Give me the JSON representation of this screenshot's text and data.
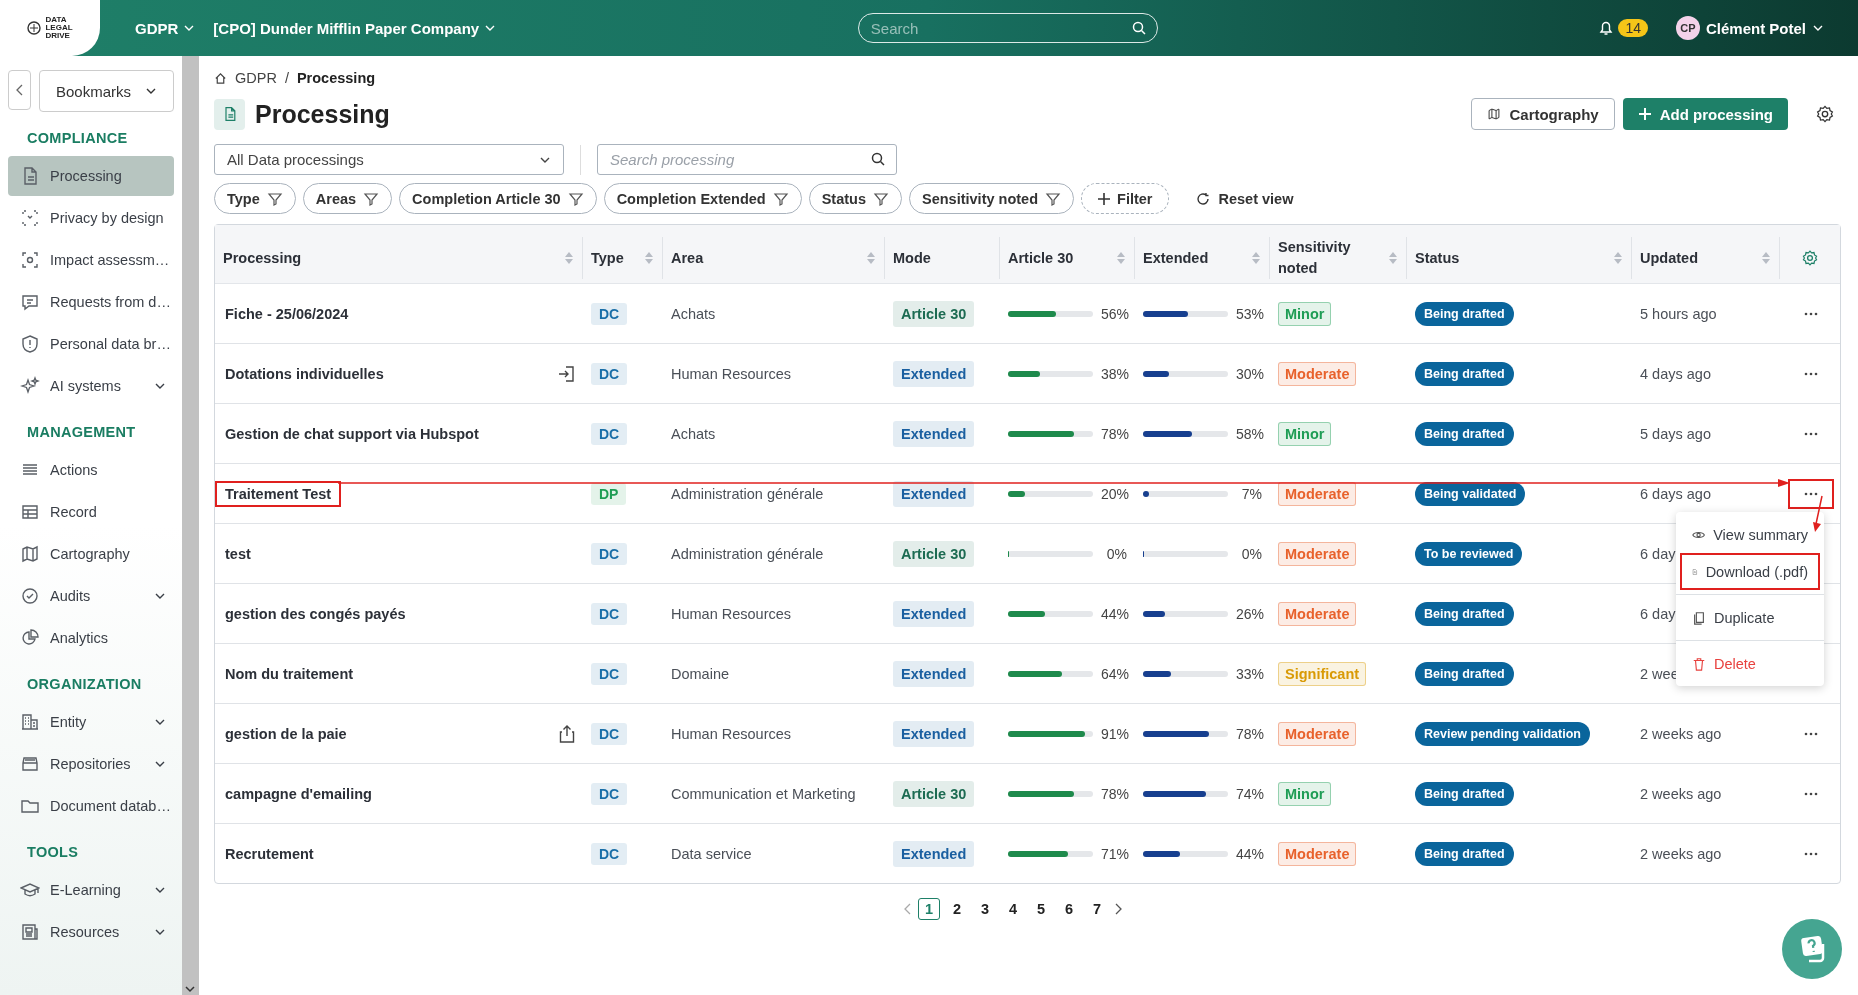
{
  "logo_text": [
    "DATA",
    "LEGAL",
    "DRIVE"
  ],
  "topbar": {
    "module": "GDPR",
    "company": "[CPO] Dunder Mifflin Paper Company",
    "search": {
      "placeholder": "Search"
    },
    "notifications": "14",
    "user_initials": "CP",
    "user_name": "Clément Potel"
  },
  "sidebar": {
    "bookmarks": "Bookmarks",
    "sections": [
      {
        "title": "COMPLIANCE",
        "items": [
          {
            "label": "Processing",
            "selected": true
          },
          {
            "label": "Privacy by design",
            "selected": false
          },
          {
            "label": "Impact assessm…",
            "selected": false
          },
          {
            "label": "Requests from d…",
            "selected": false
          },
          {
            "label": "Personal data br…",
            "selected": false
          },
          {
            "label": "AI systems",
            "selected": false,
            "expandable": true
          }
        ]
      },
      {
        "title": "MANAGEMENT",
        "items": [
          {
            "label": "Actions",
            "selected": false
          },
          {
            "label": "Record",
            "selected": false
          },
          {
            "label": "Cartography",
            "selected": false
          },
          {
            "label": "Audits",
            "selected": false,
            "expandable": true
          },
          {
            "label": "Analytics",
            "selected": false
          }
        ]
      },
      {
        "title": "ORGANIZATION",
        "items": [
          {
            "label": "Entity",
            "selected": false,
            "expandable": true
          },
          {
            "label": "Repositories",
            "selected": false,
            "expandable": true
          },
          {
            "label": "Document datab…",
            "selected": false
          }
        ]
      },
      {
        "title": "TOOLS",
        "items": [
          {
            "label": "E-Learning",
            "selected": false,
            "expandable": true
          },
          {
            "label": "Resources",
            "selected": false,
            "expandable": true
          }
        ]
      }
    ]
  },
  "breadcrumb": {
    "items": [
      "GDPR",
      "Processing"
    ],
    "separator": "/"
  },
  "page_title": "Processing",
  "buttons": {
    "cartography": "Cartography",
    "add": "Add processing"
  },
  "view_select": "All Data processings",
  "search": {
    "placeholder": "Search processing"
  },
  "filters": [
    "Type",
    "Areas",
    "Completion Article 30",
    "Completion Extended",
    "Status",
    "Sensitivity noted"
  ],
  "add_filter": "Filter",
  "reset_view": "Reset view",
  "table": {
    "columns": [
      {
        "label": "Processing",
        "sortable": true
      },
      {
        "label": "Type",
        "sortable": true
      },
      {
        "label": "Area",
        "sortable": true
      },
      {
        "label": "Mode",
        "sortable": false
      },
      {
        "label": "Article 30",
        "sortable": true
      },
      {
        "label": "Extended",
        "sortable": true
      },
      {
        "label": "Sensitivity noted",
        "sortable": true
      },
      {
        "label": "Status",
        "sortable": true
      },
      {
        "label": "Updated",
        "sortable": true
      }
    ],
    "rows": [
      {
        "name": "Fiche - 25/06/2024",
        "type": {
          "text": "DC",
          "color": "#1a6fa8"
        },
        "area": "Achats",
        "mode": {
          "text": "Article 30",
          "color": "#1c6b52"
        },
        "article30": {
          "level": 0.56,
          "text": "56%"
        },
        "extended": {
          "level": 0.53,
          "text": "53%"
        },
        "sensitivity": {
          "text": "Minor",
          "color": "#1f9d55"
        },
        "status": "Being drafted",
        "updated": "5 hours ago",
        "highlighted": false
      },
      {
        "name": "Dotations individuelles",
        "imported": true,
        "type": {
          "text": "DC",
          "color": "#1a6fa8"
        },
        "area": "Human Resources",
        "mode": {
          "text": "Extended",
          "color": "#1a5fa0"
        },
        "article30": {
          "level": 0.38,
          "text": "38%"
        },
        "extended": {
          "level": 0.3,
          "text": "30%"
        },
        "sensitivity": {
          "text": "Moderate",
          "color": "#e8622c"
        },
        "status": "Being drafted",
        "updated": "4 days ago",
        "highlighted": false
      },
      {
        "name": "Gestion de chat support via Hubspot",
        "type": {
          "text": "DC",
          "color": "#1a6fa8"
        },
        "area": "Achats",
        "mode": {
          "text": "Extended",
          "color": "#1a5fa0"
        },
        "article30": {
          "level": 0.78,
          "text": "78%"
        },
        "extended": {
          "level": 0.58,
          "text": "58%"
        },
        "sensitivity": {
          "text": "Minor",
          "color": "#1f9d55"
        },
        "status": "Being drafted",
        "updated": "5 days ago",
        "highlighted": false
      },
      {
        "name": "Traitement Test",
        "type": {
          "text": "DP",
          "color": "#1f9d55"
        },
        "area": "Administration générale",
        "mode": {
          "text": "Extended",
          "color": "#1a5fa0"
        },
        "article30": {
          "level": 0.2,
          "text": "20%"
        },
        "extended": {
          "level": 0.07,
          "text": "7%"
        },
        "sensitivity": {
          "text": "Moderate",
          "color": "#e8622c"
        },
        "status": "Being validated",
        "updated": "6 days ago",
        "highlighted": true,
        "menu": [
          {
            "label": "View summary",
            "kind": "normal",
            "highlighted": false
          },
          {
            "label": "Download (.pdf)",
            "kind": "normal",
            "highlighted": true
          },
          {
            "label": "Duplicate",
            "kind": "normal",
            "highlighted": false
          },
          {
            "label": "Delete",
            "kind": "danger",
            "highlighted": false
          }
        ]
      },
      {
        "name": "test",
        "type": {
          "text": "DC",
          "color": "#1a6fa8"
        },
        "area": "Administration générale",
        "mode": {
          "text": "Article 30",
          "color": "#1c6b52"
        },
        "article30": {
          "level": 0,
          "text": "0%"
        },
        "extended": {
          "level": 0,
          "text": "0%"
        },
        "sensitivity": {
          "text": "Moderate",
          "color": "#e8622c"
        },
        "status": "To be reviewed",
        "updated": "6 day",
        "highlighted": false
      },
      {
        "name": "gestion des congés payés",
        "type": {
          "text": "DC",
          "color": "#1a6fa8"
        },
        "area": "Human Resources",
        "mode": {
          "text": "Extended",
          "color": "#1a5fa0"
        },
        "article30": {
          "level": 0.44,
          "text": "44%"
        },
        "extended": {
          "level": 0.26,
          "text": "26%"
        },
        "sensitivity": {
          "text": "Moderate",
          "color": "#e8622c"
        },
        "status": "Being drafted",
        "updated": "6 day",
        "highlighted": false
      },
      {
        "name": "Nom du traitement",
        "type": {
          "text": "DC",
          "color": "#1a6fa8"
        },
        "area": "Domaine",
        "mode": {
          "text": "Extended",
          "color": "#1a5fa0"
        },
        "article30": {
          "level": 0.64,
          "text": "64%"
        },
        "extended": {
          "level": 0.33,
          "text": "33%"
        },
        "sensitivity": {
          "text": "Significant",
          "color": "#d99a06"
        },
        "status": "Being drafted",
        "updated": "2 wee",
        "highlighted": false
      },
      {
        "name": "gestion de la paie",
        "shared": true,
        "type": {
          "text": "DC",
          "color": "#1a6fa8"
        },
        "area": "Human Resources",
        "mode": {
          "text": "Extended",
          "color": "#1a5fa0"
        },
        "article30": {
          "level": 0.91,
          "text": "91%"
        },
        "extended": {
          "level": 0.78,
          "text": "78%"
        },
        "sensitivity": {
          "text": "Moderate",
          "color": "#e8622c"
        },
        "status": "Review pending validation",
        "updated": "2 weeks ago",
        "highlighted": false
      },
      {
        "name": "campagne d'emailing",
        "type": {
          "text": "DC",
          "color": "#1a6fa8"
        },
        "area": "Communication et Marketing",
        "mode": {
          "text": "Article 30",
          "color": "#1c6b52"
        },
        "article30": {
          "level": 0.78,
          "text": "78%"
        },
        "extended": {
          "level": 0.74,
          "text": "74%"
        },
        "sensitivity": {
          "text": "Minor",
          "color": "#1f9d55"
        },
        "status": "Being drafted",
        "updated": "2 weeks ago",
        "highlighted": false
      },
      {
        "name": "Recrutement",
        "type": {
          "text": "DC",
          "color": "#1a6fa8"
        },
        "area": "Data service",
        "mode": {
          "text": "Extended",
          "color": "#1a5fa0"
        },
        "article30": {
          "level": 0.71,
          "text": "71%"
        },
        "extended": {
          "level": 0.44,
          "text": "44%"
        },
        "sensitivity": {
          "text": "Moderate",
          "color": "#e8622c"
        },
        "status": "Being drafted",
        "updated": "2 weeks ago",
        "highlighted": false
      }
    ]
  },
  "pagination": [
    {
      "label": "1",
      "selected": true
    },
    {
      "label": "2",
      "selected": false
    },
    {
      "label": "3",
      "selected": false
    },
    {
      "label": "4",
      "selected": false
    },
    {
      "label": "5",
      "selected": false
    },
    {
      "label": "6",
      "selected": false
    },
    {
      "label": "7",
      "selected": false
    }
  ]
}
